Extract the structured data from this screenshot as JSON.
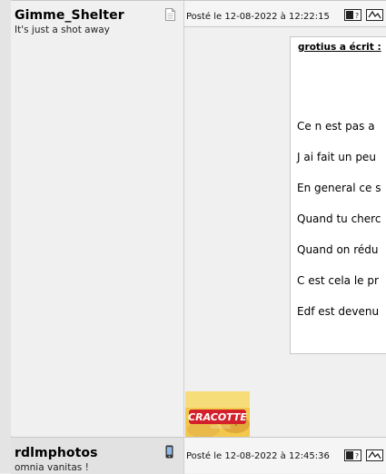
{
  "posts": [
    {
      "author": "Gimme_Shelter",
      "subtitle": "It's just a shot away",
      "posted": "Posté le 12-08-2022 à 12:22:15",
      "quote": {
        "author": "grotius a écrit :",
        "lines": [
          "Ce n est pas a",
          "J ai fait un peu",
          "En general ce s",
          "Quand tu cherc",
          "Quand on rédu",
          "C est cela le pr",
          "Edf est devenu"
        ]
      },
      "image_text": "CRACOTTE",
      "icons": [
        "profile-page-icon",
        "quote-icon",
        "edit-icon"
      ]
    },
    {
      "author": "rdlmphotos",
      "subtitle": "omnia vanitas !",
      "posted": "Posté le 12-08-2022 à 12:45:36",
      "icons": [
        "mobile-phone-icon",
        "quote-icon",
        "edit-icon"
      ]
    }
  ]
}
